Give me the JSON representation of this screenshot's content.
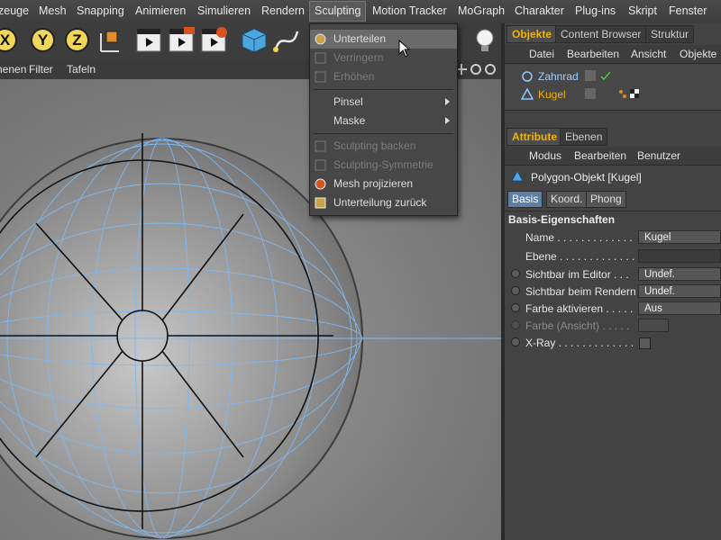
{
  "menubar": {
    "items": [
      "zeuge",
      "Mesh",
      "Snapping",
      "Animieren",
      "Simulieren",
      "Rendern",
      "Sculpting",
      "Motion Tracker",
      "MoGraph",
      "Charakter",
      "Plug-ins",
      "Skript",
      "Fenster"
    ],
    "active": "Sculpting"
  },
  "toolbar": {
    "axis_x": "X",
    "axis_y": "Y",
    "axis_z": "Z"
  },
  "viewport_menu": [
    "henen",
    "Filter",
    "Tafeln"
  ],
  "sculpting_menu": {
    "items": [
      {
        "label": "Unterteilen",
        "state": "highlighted",
        "icon": "subdivide-icon"
      },
      {
        "label": "Verringern",
        "state": "disabled",
        "icon": "reduce-icon"
      },
      {
        "label": "Erhöhen",
        "state": "disabled",
        "icon": "increase-icon"
      },
      {
        "label": "Pinsel",
        "state": "submenu"
      },
      {
        "label": "Maske",
        "state": "submenu"
      },
      {
        "label": "Sculpting backen",
        "state": "disabled",
        "icon": "bake-icon"
      },
      {
        "label": "Sculpting-Symmetrie",
        "state": "disabled",
        "icon": "symmetry-icon"
      },
      {
        "label": "Mesh projizieren",
        "state": "enabled",
        "icon": "project-mesh-icon"
      },
      {
        "label": "Unterteilung zurück",
        "state": "enabled",
        "icon": "subdivision-back-icon"
      }
    ]
  },
  "objects_panel": {
    "tabs": [
      "Objekte",
      "Content Browser",
      "Struktur"
    ],
    "active_tab": "Objekte",
    "menu": [
      "Datei",
      "Bearbeiten",
      "Ansicht",
      "Objekte"
    ],
    "objects": [
      {
        "name": "Zahnrad",
        "selected": false,
        "icon": "circle-spline-icon"
      },
      {
        "name": "Kugel",
        "selected": true,
        "icon": "polygon-object-icon"
      }
    ]
  },
  "attributes_panel": {
    "tabs": [
      "Attribute",
      "Ebenen"
    ],
    "active_tab": "Attribute",
    "menu": [
      "Modus",
      "Bearbeiten",
      "Benutzer"
    ],
    "object_title": "Polygon-Objekt [Kugel]",
    "sub_tabs": [
      "Basis",
      "Koord.",
      "Phong"
    ],
    "active_sub_tab": "Basis",
    "section_title": "Basis-Eigenschaften",
    "rows": [
      {
        "label": "Name . . . . . . . . . . . . .",
        "value": "Kugel",
        "radio": false,
        "disabled": false
      },
      {
        "label": "Ebene . . . . . . . . . . . . .",
        "value": "",
        "radio": false,
        "disabled": false
      },
      {
        "label": "Sichtbar im Editor . . .",
        "value": "Undef.",
        "radio": true,
        "disabled": false
      },
      {
        "label": "Sichtbar beim Rendern",
        "value": "Undef.",
        "radio": true,
        "disabled": false
      },
      {
        "label": "Farbe aktivieren . . . . .",
        "value": "Aus",
        "radio": true,
        "disabled": false
      },
      {
        "label": "Farbe (Ansicht) . . . . .",
        "value": "",
        "radio": true,
        "disabled": true
      },
      {
        "label": "X-Ray . . . . . . . . . . . . .",
        "value": "",
        "radio": true,
        "disabled": false,
        "checkbox": true
      }
    ]
  },
  "colors": {
    "accent_orange": "#f0b400",
    "highlight_blue": "#5f7ea4",
    "wireframe": "#8fbfff"
  }
}
